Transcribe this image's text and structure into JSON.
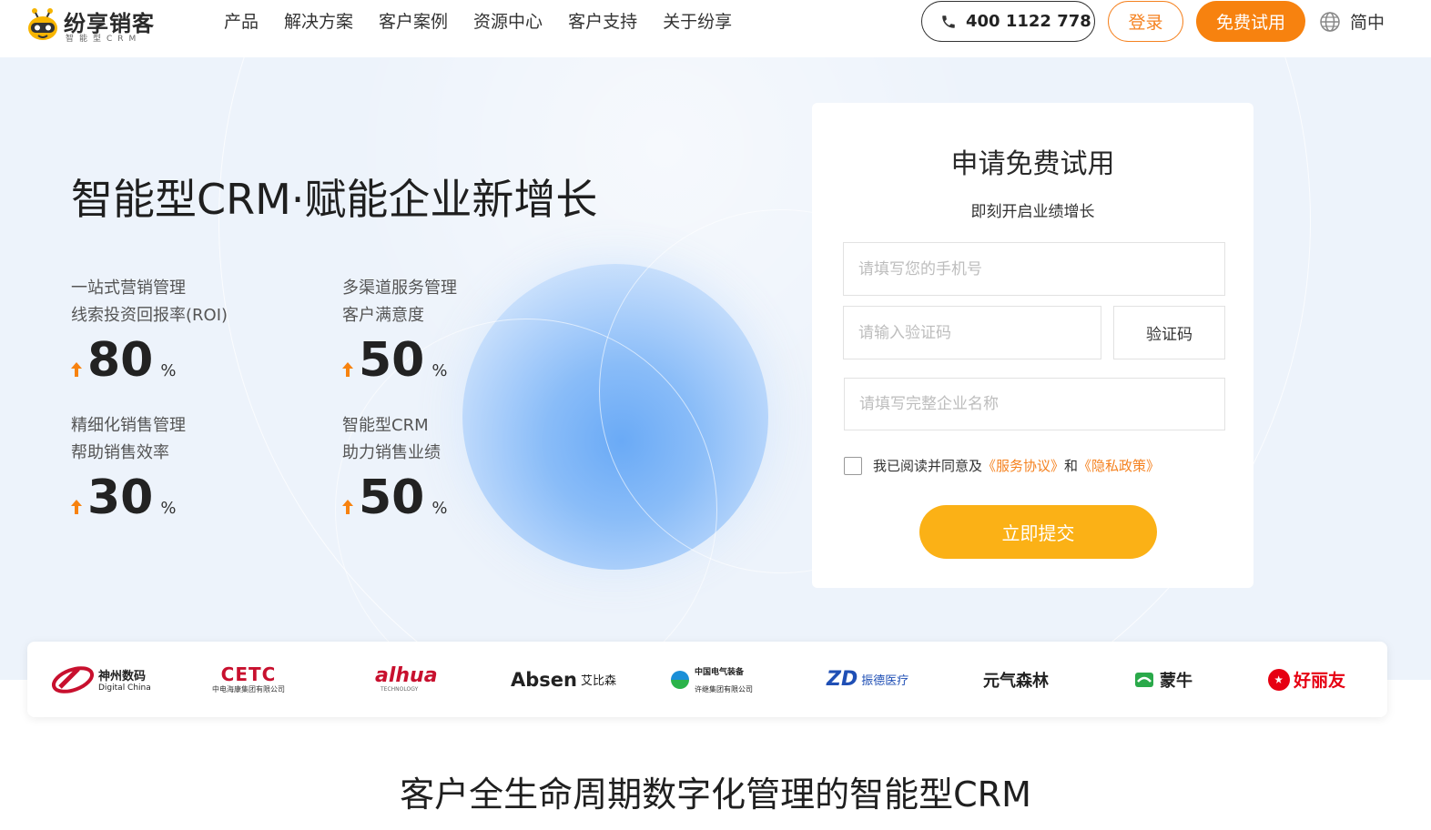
{
  "header": {
    "logo_name": "纷享销客",
    "logo_tagline": "智能型CRM",
    "nav": [
      "产品",
      "解决方案",
      "客户案例",
      "资源中心",
      "客户支持",
      "关于纷享"
    ],
    "phone": "400 1122 778",
    "login_label": "登录",
    "trial_label": "免费试用",
    "language": "简中"
  },
  "hero": {
    "title": "智能型CRM·赋能企业新增长",
    "stats": [
      {
        "line1": "一站式营销管理",
        "line2": "线索投资回报率(ROI)",
        "value": "80",
        "unit": "%"
      },
      {
        "line1": "多渠道服务管理",
        "line2": "客户满意度",
        "value": "50",
        "unit": "%"
      },
      {
        "line1": "精细化销售管理",
        "line2": "帮助销售效率",
        "value": "30",
        "unit": "%"
      },
      {
        "line1": "智能型CRM",
        "line2": "助力销售业绩",
        "value": "50",
        "unit": "%"
      }
    ]
  },
  "form": {
    "title": "申请免费试用",
    "subtitle": "即刻开启业绩增长",
    "phone_placeholder": "请填写您的手机号",
    "code_placeholder": "请输入验证码",
    "code_button": "验证码",
    "company_placeholder": "请填写完整企业名称",
    "agree_prefix": "我已阅读并同意及",
    "agree_link1": "《服务协议》",
    "agree_and": "和",
    "agree_link2": "《隐私政策》",
    "submit_label": "立即提交"
  },
  "brands": [
    {
      "name": "神州数码",
      "sub": "Digital China"
    },
    {
      "name": "CETC",
      "sub": "中电海康集团有限公司"
    },
    {
      "name": "alhua",
      "sub": "TECHNOLOGY"
    },
    {
      "name": "Absen",
      "sub": "艾比森"
    },
    {
      "name": "中国电气装备",
      "sub": "许继集团有限公司"
    },
    {
      "name": "ZD",
      "sub": "振德医疗"
    },
    {
      "name": "元气森林",
      "sub": ""
    },
    {
      "name": "蒙牛",
      "sub": ""
    },
    {
      "name": "好丽友",
      "sub": ""
    }
  ],
  "section": {
    "title": "客户全生命周期数字化管理的智能型CRM"
  },
  "colors": {
    "accent_orange": "#f7820f",
    "submit_yellow": "#fbb116",
    "hero_bg": "#edf3fb"
  }
}
